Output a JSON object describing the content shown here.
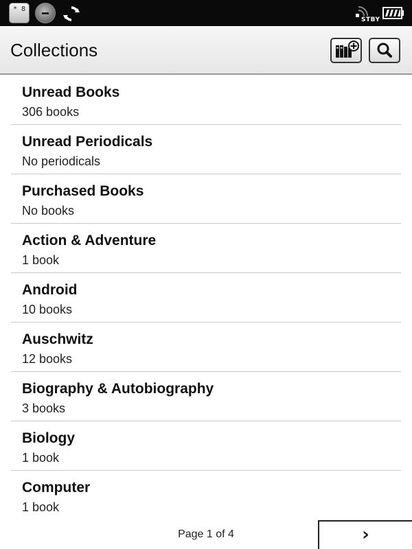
{
  "status_bar": {
    "keypad_label": "* 8",
    "standby_label": "STBY",
    "icons": [
      "keypad-icon",
      "music-player-icon",
      "sync-icon",
      "wireless-icon",
      "battery-icon"
    ]
  },
  "header": {
    "title": "Collections",
    "buttons": [
      "add-collection-icon",
      "search-icon"
    ]
  },
  "collections": [
    {
      "name": "Unread Books",
      "count": "306 books"
    },
    {
      "name": "Unread Periodicals",
      "count": "No periodicals"
    },
    {
      "name": "Purchased Books",
      "count": "No books"
    },
    {
      "name": "Action & Adventure",
      "count": "1 book"
    },
    {
      "name": "Android",
      "count": "10 books"
    },
    {
      "name": "Auschwitz",
      "count": "12 books"
    },
    {
      "name": "Biography & Autobiography",
      "count": "3 books"
    },
    {
      "name": "Biology",
      "count": "1 book"
    },
    {
      "name": "Computer",
      "count": "1 book"
    }
  ],
  "footer": {
    "page_info": "Page 1 of 4",
    "next_label": "›"
  }
}
